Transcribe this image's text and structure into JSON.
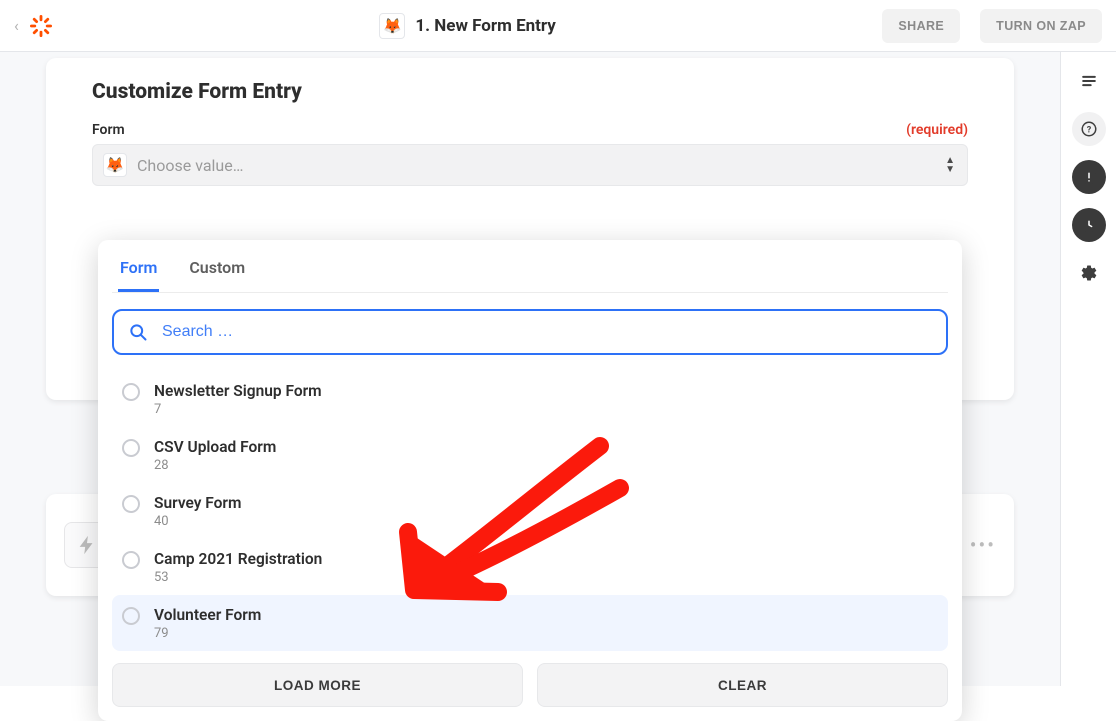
{
  "header": {
    "title": "1. New Form Entry",
    "app_icon_glyph": "🦊",
    "share_label": "SHARE",
    "turn_on_label": "TURN ON ZAP"
  },
  "card": {
    "heading": "Customize Form Entry",
    "field_label": "Form",
    "required_label": "(required)",
    "select_placeholder": "Choose value…",
    "select_icon_glyph": "🦊"
  },
  "dropdown": {
    "tabs": {
      "form": "Form",
      "custom": "Custom"
    },
    "search_placeholder": "Search …",
    "options": [
      {
        "name": "Newsletter Signup Form",
        "id": "7"
      },
      {
        "name": "CSV Upload Form",
        "id": "28"
      },
      {
        "name": "Survey Form",
        "id": "40"
      },
      {
        "name": "Camp 2021 Registration",
        "id": "53"
      },
      {
        "name": "Volunteer Form",
        "id": "79"
      }
    ],
    "load_more_label": "LOAD MORE",
    "clear_label": "CLEAR"
  },
  "sidebar_icons": [
    "lines",
    "help",
    "alert",
    "clock",
    "gear"
  ]
}
